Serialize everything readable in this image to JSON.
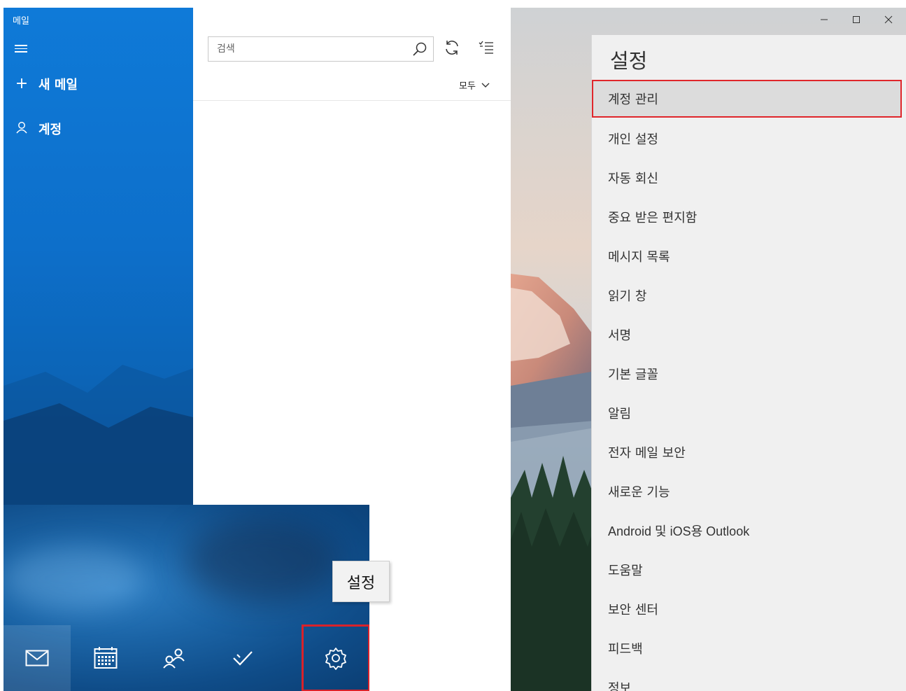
{
  "app": {
    "title": "메일"
  },
  "nav": {
    "new_mail": "새 메일",
    "accounts": "계정"
  },
  "search": {
    "placeholder": "검색"
  },
  "filter": {
    "label": "모두"
  },
  "tooltip": {
    "text": "설정"
  },
  "settings": {
    "title": "설정",
    "items": [
      {
        "label": "계정 관리",
        "selected": true
      },
      {
        "label": "개인 설정"
      },
      {
        "label": "자동 회신"
      },
      {
        "label": "중요 받은 편지함"
      },
      {
        "label": "메시지 목록"
      },
      {
        "label": "읽기 창"
      },
      {
        "label": "서명"
      },
      {
        "label": "기본 글꼴"
      },
      {
        "label": "알림"
      },
      {
        "label": "전자 메일 보안"
      },
      {
        "label": "새로운 기능"
      },
      {
        "label": "Android 및 iOS용 Outlook"
      },
      {
        "label": "도움말"
      },
      {
        "label": "보안 센터"
      },
      {
        "label": "피드백"
      },
      {
        "label": "정보"
      }
    ]
  },
  "bottom_bar": {
    "icons": [
      "mail-icon",
      "calendar-icon",
      "people-icon",
      "todo-icon",
      "gear-icon"
    ]
  },
  "colors": {
    "nav_blue": "#0f7ad8",
    "highlight_red": "#e0262b",
    "settings_bg": "#f0f0f0"
  }
}
